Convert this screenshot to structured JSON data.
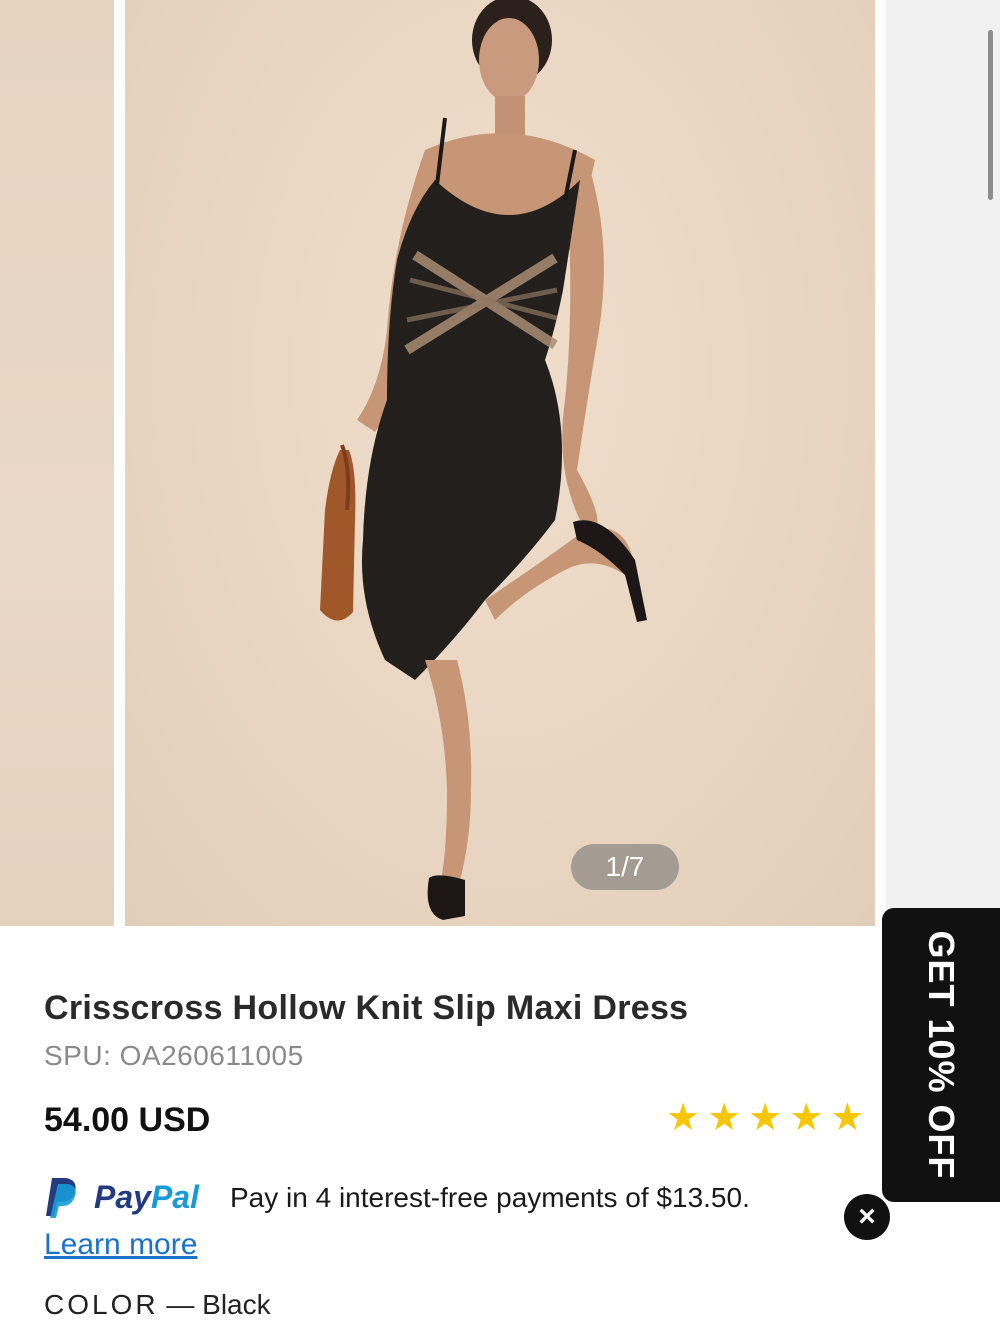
{
  "gallery": {
    "counter": "1/7",
    "images": [
      {
        "alt": "Model wearing black crisscross hollow knit slip maxi dress"
      }
    ]
  },
  "product": {
    "title": "Crisscross Hollow Knit Slip Maxi Dress",
    "spu": "SPU: OA260611005",
    "price": "54.00 USD",
    "rating": 5,
    "stars": [
      "★",
      "★",
      "★",
      "★",
      "★"
    ]
  },
  "paypal": {
    "brand_pay": "Pay",
    "brand_pal": "Pal",
    "message": "Pay in 4 interest-free payments of $13.50.",
    "learn_more": "Learn more"
  },
  "color": {
    "label": "COLOR",
    "separator": "—",
    "value": "Black"
  },
  "promo_tab": {
    "label": "GET 10% OFF",
    "close_icon": "×"
  },
  "colors": {
    "star": "#f7c600",
    "paypal_blue_dark": "#253b80",
    "paypal_blue_light": "#179bd7",
    "link": "#1a73c8",
    "dress": "#231f1c"
  }
}
